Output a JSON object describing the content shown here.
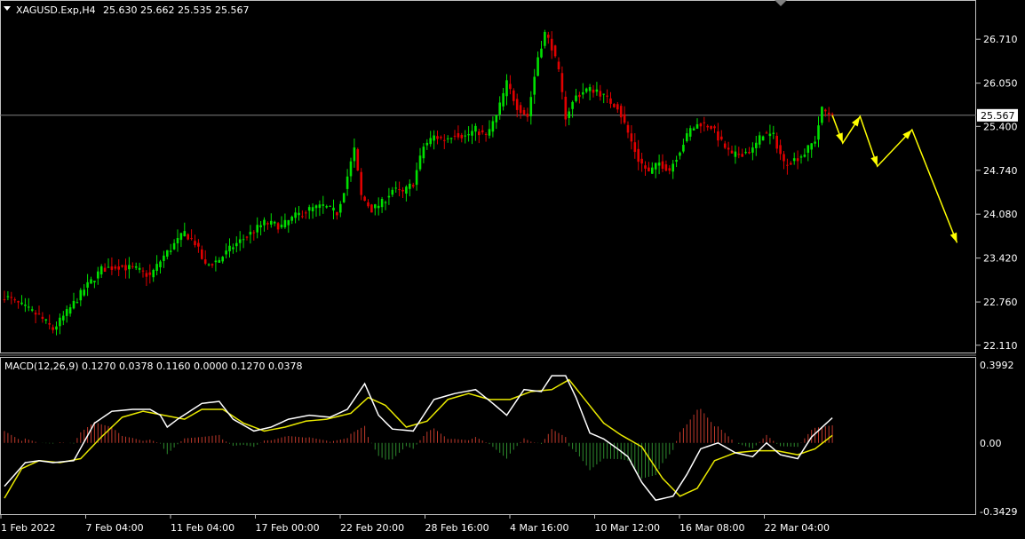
{
  "header": {
    "symbol": "XAGUSD.Exp,H4",
    "ohlc": "25.630 25.662 25.535 25.567",
    "macd_label": "MACD(12,26,9) 0.1270 0.0378 0.1160 0.0000 0.1270 0.0378"
  },
  "colors": {
    "background": "#000000",
    "bull": "#00e000",
    "bear": "#e00000",
    "hist_pos": "#c0392b",
    "hist_neg": "#2e8b2e",
    "macd_line": "#ffffff",
    "signal_line": "#e8e800",
    "arrow": "#ffff00",
    "price_line": "#808080"
  },
  "chart_data": {
    "type": "candlestick",
    "price_axis": {
      "ticks": [
        "26.710",
        "26.050",
        "25.400",
        "24.740",
        "24.080",
        "23.420",
        "22.760",
        "22.110"
      ],
      "ylim": [
        22.0,
        27.3
      ],
      "current_price": "25.567"
    },
    "macd_axis": {
      "ticks": [
        "0.3992",
        "0.00",
        "-0.3429"
      ],
      "ylim": [
        -0.3429,
        0.3992
      ]
    },
    "time_labels": [
      "1 Feb 2022",
      "7 Feb 04:00",
      "11 Feb 04:00",
      "17 Feb 00:00",
      "22 Feb 20:00",
      "28 Feb 16:00",
      "4 Mar 16:00",
      "10 Mar 12:00",
      "16 Mar 08:00",
      "22 Mar 04:00"
    ],
    "close_anchors": [
      [
        0,
        22.85
      ],
      [
        5,
        22.7
      ],
      [
        10,
        22.55
      ],
      [
        14,
        22.35
      ],
      [
        18,
        22.6
      ],
      [
        23,
        22.95
      ],
      [
        28,
        23.25
      ],
      [
        33,
        23.3
      ],
      [
        38,
        23.25
      ],
      [
        42,
        23.15
      ],
      [
        46,
        23.45
      ],
      [
        52,
        23.8
      ],
      [
        55,
        23.65
      ],
      [
        58,
        23.3
      ],
      [
        62,
        23.4
      ],
      [
        66,
        23.6
      ],
      [
        70,
        23.75
      ],
      [
        75,
        23.95
      ],
      [
        80,
        23.9
      ],
      [
        84,
        24.05
      ],
      [
        88,
        24.15
      ],
      [
        92,
        24.2
      ],
      [
        96,
        24.1
      ],
      [
        98,
        24.45
      ],
      [
        101,
        25.05
      ],
      [
        103,
        24.35
      ],
      [
        106,
        24.15
      ],
      [
        109,
        24.25
      ],
      [
        112,
        24.45
      ],
      [
        115,
        24.4
      ],
      [
        118,
        24.55
      ],
      [
        121,
        25.1
      ],
      [
        124,
        25.25
      ],
      [
        127,
        25.2
      ],
      [
        130,
        25.3
      ],
      [
        133,
        25.25
      ],
      [
        136,
        25.35
      ],
      [
        139,
        25.25
      ],
      [
        142,
        25.55
      ],
      [
        145,
        26.05
      ],
      [
        148,
        25.7
      ],
      [
        151,
        25.55
      ],
      [
        154,
        26.45
      ],
      [
        156,
        26.8
      ],
      [
        158,
        26.6
      ],
      [
        160,
        26.2
      ],
      [
        162,
        25.55
      ],
      [
        165,
        25.85
      ],
      [
        168,
        25.95
      ],
      [
        171,
        25.95
      ],
      [
        174,
        25.8
      ],
      [
        177,
        25.7
      ],
      [
        180,
        25.3
      ],
      [
        183,
        24.9
      ],
      [
        186,
        24.7
      ],
      [
        189,
        24.85
      ],
      [
        192,
        24.75
      ],
      [
        195,
        25.05
      ],
      [
        198,
        25.35
      ],
      [
        201,
        25.45
      ],
      [
        204,
        25.4
      ],
      [
        207,
        25.15
      ],
      [
        210,
        24.95
      ],
      [
        213,
        25.0
      ],
      [
        216,
        25.05
      ],
      [
        219,
        25.3
      ],
      [
        222,
        25.25
      ],
      [
        225,
        24.85
      ],
      [
        228,
        24.9
      ],
      [
        231,
        25.0
      ],
      [
        234,
        25.2
      ],
      [
        236,
        25.65
      ],
      [
        239,
        25.567
      ]
    ],
    "macd_anchors": [
      [
        0,
        -0.22
      ],
      [
        6,
        -0.1
      ],
      [
        10,
        -0.09
      ],
      [
        14,
        -0.1
      ],
      [
        20,
        -0.09
      ],
      [
        26,
        0.1
      ],
      [
        31,
        0.16
      ],
      [
        37,
        0.17
      ],
      [
        42,
        0.17
      ],
      [
        45,
        0.14
      ],
      [
        47,
        0.08
      ],
      [
        50,
        0.12
      ],
      [
        57,
        0.2
      ],
      [
        62,
        0.21
      ],
      [
        66,
        0.12
      ],
      [
        72,
        0.06
      ],
      [
        77,
        0.08
      ],
      [
        82,
        0.12
      ],
      [
        88,
        0.14
      ],
      [
        94,
        0.13
      ],
      [
        99,
        0.17
      ],
      [
        104,
        0.3
      ],
      [
        108,
        0.14
      ],
      [
        112,
        0.07
      ],
      [
        118,
        0.06
      ],
      [
        124,
        0.22
      ],
      [
        130,
        0.25
      ],
      [
        136,
        0.27
      ],
      [
        141,
        0.2
      ],
      [
        145,
        0.14
      ],
      [
        150,
        0.27
      ],
      [
        155,
        0.26
      ],
      [
        158,
        0.34
      ],
      [
        162,
        0.34
      ],
      [
        165,
        0.23
      ],
      [
        169,
        0.05
      ],
      [
        173,
        0.02
      ],
      [
        177,
        -0.03
      ],
      [
        180,
        -0.07
      ],
      [
        184,
        -0.2
      ],
      [
        188,
        -0.29
      ],
      [
        193,
        -0.27
      ],
      [
        197,
        -0.16
      ],
      [
        201,
        -0.03
      ],
      [
        206,
        0.0
      ],
      [
        211,
        -0.05
      ],
      [
        216,
        -0.07
      ],
      [
        220,
        0.0
      ],
      [
        224,
        -0.06
      ],
      [
        229,
        -0.08
      ],
      [
        233,
        0.03
      ],
      [
        239,
        0.127
      ]
    ],
    "signal_anchors": [
      [
        0,
        -0.28
      ],
      [
        5,
        -0.13
      ],
      [
        10,
        -0.09
      ],
      [
        16,
        -0.1
      ],
      [
        22,
        -0.08
      ],
      [
        28,
        0.03
      ],
      [
        34,
        0.13
      ],
      [
        40,
        0.16
      ],
      [
        46,
        0.14
      ],
      [
        52,
        0.12
      ],
      [
        57,
        0.17
      ],
      [
        63,
        0.17
      ],
      [
        69,
        0.1
      ],
      [
        75,
        0.06
      ],
      [
        81,
        0.08
      ],
      [
        87,
        0.11
      ],
      [
        93,
        0.12
      ],
      [
        100,
        0.15
      ],
      [
        105,
        0.23
      ],
      [
        110,
        0.19
      ],
      [
        116,
        0.08
      ],
      [
        122,
        0.11
      ],
      [
        128,
        0.22
      ],
      [
        134,
        0.25
      ],
      [
        140,
        0.22
      ],
      [
        146,
        0.22
      ],
      [
        152,
        0.26
      ],
      [
        158,
        0.27
      ],
      [
        163,
        0.32
      ],
      [
        168,
        0.21
      ],
      [
        173,
        0.1
      ],
      [
        178,
        0.04
      ],
      [
        184,
        -0.02
      ],
      [
        190,
        -0.18
      ],
      [
        195,
        -0.27
      ],
      [
        200,
        -0.23
      ],
      [
        205,
        -0.09
      ],
      [
        211,
        -0.05
      ],
      [
        217,
        -0.04
      ],
      [
        223,
        -0.04
      ],
      [
        229,
        -0.06
      ],
      [
        234,
        -0.03
      ],
      [
        239,
        0.038
      ]
    ],
    "forecast_arrow": [
      [
        239,
        25.567
      ],
      [
        242,
        25.15
      ],
      [
        247,
        25.55
      ],
      [
        252,
        24.8
      ],
      [
        262,
        25.35
      ],
      [
        275,
        23.65
      ]
    ]
  }
}
